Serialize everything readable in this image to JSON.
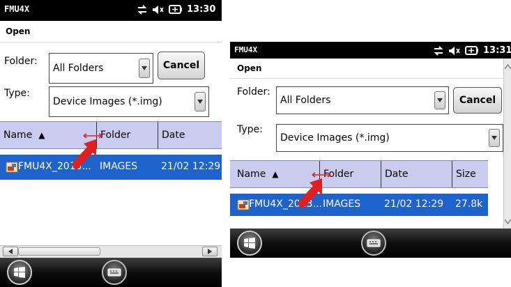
{
  "screens": [
    {
      "status": {
        "title": "FMU4X",
        "time": "13:30"
      },
      "menu": {
        "open_label": "Open"
      },
      "folder": {
        "label": "Folder:",
        "value": "All Folders"
      },
      "cancel_label": "Cancel",
      "type": {
        "label": "Type:",
        "value": "Device Images (*.img)"
      },
      "columns": {
        "name": "Name",
        "sort_indicator": "▲",
        "folder": "Folder",
        "date": "Date"
      },
      "files": [
        {
          "name": "FMU4X_2013...",
          "folder": "IMAGES",
          "date": "21/02 12:29"
        }
      ]
    },
    {
      "status": {
        "title": "FMU4X",
        "time": "13:31"
      },
      "menu": {
        "open_label": "Open"
      },
      "folder": {
        "label": "Folder:",
        "value": "All Folders"
      },
      "cancel_label": "Cancel",
      "type": {
        "label": "Type:",
        "value": "Device Images (*.img)"
      },
      "columns": {
        "name": "Name",
        "sort_indicator": "▲",
        "folder": "Folder",
        "date": "Date",
        "size": "Size"
      },
      "files": [
        {
          "name": "FMU4X_2013...",
          "folder": "IMAGES",
          "date": "21/02 12:29",
          "size": "27.8k"
        }
      ]
    }
  ],
  "icons": {
    "connection": "sync-arrows-icon",
    "volume": "speaker-muted-icon",
    "battery": "battery-icon",
    "start": "windows-start-icon",
    "keyboard": "keyboard-icon",
    "file": "image-file-icon",
    "resize": "column-resize-arrow-icon",
    "pointer": "red-pointer-arrow-icon"
  },
  "colors": {
    "selection": "#1e62cc",
    "header": "#c9cbef",
    "pointer": "#e02020",
    "statusbar": "#000000"
  }
}
